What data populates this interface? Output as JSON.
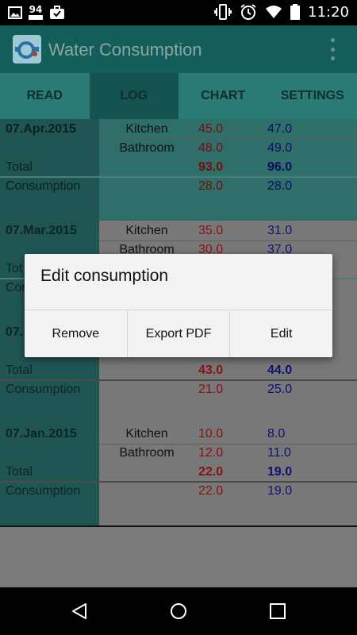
{
  "status_bar": {
    "time": "11:20",
    "notification_badge": "94",
    "icons": [
      "image-icon",
      "battery-saver-icon",
      "briefcase-icon",
      "vibrate-icon",
      "alarm-icon",
      "wifi-icon",
      "battery-icon"
    ]
  },
  "app_bar": {
    "title": "Water Consumption",
    "logo_icon": "water-meter-icon",
    "menu_icon": "overflow-menu-icon"
  },
  "tabs": [
    {
      "label": "READ",
      "active": false
    },
    {
      "label": "LOG",
      "active": true
    },
    {
      "label": "CHART",
      "active": false
    },
    {
      "label": "SETTINGS",
      "active": false
    }
  ],
  "log": [
    {
      "date": "07.Apr.2015",
      "rows": [
        {
          "location": "Kitchen",
          "v1": "45.0",
          "v2": "47.0"
        },
        {
          "location": "Bathroom",
          "v1": "48.0",
          "v2": "49.0"
        }
      ],
      "total_label": "Total",
      "total_v1": "93.0",
      "total_v2": "96.0",
      "consumption_label": "Consumption",
      "consumption_v1": "28.0",
      "consumption_v2": "28.0"
    },
    {
      "date": "07.Mar.2015",
      "rows": [
        {
          "location": "Kitchen",
          "v1": "35.0",
          "v2": "31.0"
        },
        {
          "location": "Bathroom",
          "v1": "30.0",
          "v2": "37.0"
        }
      ],
      "total_label": "Tot",
      "consumption_label": "Con"
    },
    {
      "date": "07.",
      "total_label": "Total",
      "total_v1": "43.0",
      "total_v2": "44.0",
      "consumption_label": "Consumption",
      "consumption_v1": "21.0",
      "consumption_v2": "25.0"
    },
    {
      "date": "07.Jan.2015",
      "rows": [
        {
          "location": "Kitchen",
          "v1": "10.0",
          "v2": "8.0"
        },
        {
          "location": "Bathroom",
          "v1": "12.0",
          "v2": "11.0"
        }
      ],
      "total_label": "Total",
      "total_v1": "22.0",
      "total_v2": "19.0",
      "consumption_label": "Consumption",
      "consumption_v1": "22.0",
      "consumption_v2": "19.0"
    }
  ],
  "dialog": {
    "title": "Edit consumption",
    "buttons": [
      "Remove",
      "Export PDF",
      "Edit"
    ]
  },
  "nav_bar": {
    "icons": [
      "back-icon",
      "home-icon",
      "recents-icon"
    ]
  },
  "colors": {
    "app_bar": "#135e5a",
    "tab_bar": "#2a7b76",
    "active_tab": "#145450",
    "date_column": "#1f5654",
    "value_red": "#8b1010",
    "value_blue": "#101075"
  }
}
